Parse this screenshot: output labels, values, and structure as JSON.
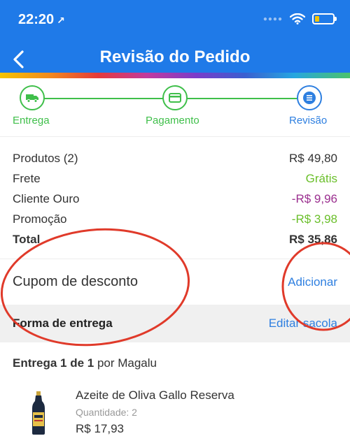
{
  "status_bar": {
    "time": "22:20",
    "location_glyph": "↗",
    "battery_level": 0.25
  },
  "header": {
    "title": "Revisão do Pedido",
    "back_icon": "chevron-left-icon"
  },
  "colors": {
    "primary": "#1f7ae8",
    "success": "#3fbf4a",
    "discount_purple": "#9b2f8f",
    "annotation_red": "#e03a2a"
  },
  "stepper": {
    "steps": [
      {
        "label": "Entrega",
        "icon": "truck-icon",
        "state": "done"
      },
      {
        "label": "Pagamento",
        "icon": "card-icon",
        "state": "done"
      },
      {
        "label": "Revisão",
        "icon": "list-icon",
        "state": "active"
      }
    ]
  },
  "summary": {
    "products_label": "Produtos (2)",
    "products_value": "R$ 49,80",
    "shipping_label": "Frete",
    "shipping_value": "Grátis",
    "gold_label": "Cliente Ouro",
    "gold_value": "-R$ 9,96",
    "promo_label": "Promoção",
    "promo_value": "-R$ 3,98",
    "total_label": "Total",
    "total_value": "R$ 35,86"
  },
  "coupon": {
    "label": "Cupom de desconto",
    "action": "Adicionar"
  },
  "delivery": {
    "title": "Forma de entrega",
    "action": "Editar sacola"
  },
  "shipment": {
    "prefix": "Entrega 1 de 1",
    "suffix": " por Magalu"
  },
  "product": {
    "name": "Azeite de Oliva Gallo Reserva",
    "quantity": "Quantidade: 2",
    "price": "R$ 17,93"
  }
}
